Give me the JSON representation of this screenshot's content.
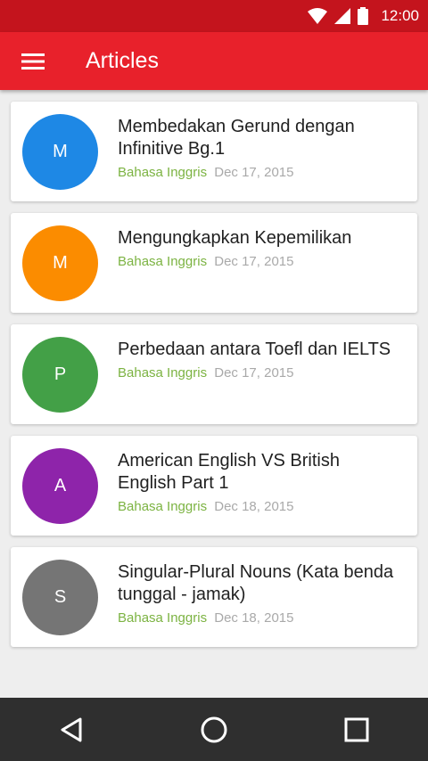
{
  "status_bar": {
    "time": "12:00"
  },
  "app_bar": {
    "title": "Articles",
    "menu_icon": "hamburger-menu-icon"
  },
  "articles": [
    {
      "initial": "M",
      "color": "#1e88e5",
      "title_line1": "Membedakan Gerund dengan",
      "title_line2": "Infinitive Bg.1",
      "category": "Bahasa Inggris",
      "date": "Dec 17, 2015"
    },
    {
      "initial": "M",
      "color": "#fb8c00",
      "title_line1": "Mengungkapkan Kepemilikan",
      "title_line2": "",
      "category": "Bahasa Inggris",
      "date": "Dec 17, 2015"
    },
    {
      "initial": "P",
      "color": "#43a047",
      "title_line1": "Perbedaan antara Toefl dan IELTS",
      "title_line2": "",
      "category": "Bahasa Inggris",
      "date": "Dec 17, 2015"
    },
    {
      "initial": "A",
      "color": "#8e24aa",
      "title_line1": "American English VS British",
      "title_line2": "English Part 1",
      "category": "Bahasa Inggris",
      "date": "Dec 18, 2015"
    },
    {
      "initial": "S",
      "color": "#757575",
      "title_line1": "Singular-Plural Nouns (Kata benda",
      "title_line2": "tunggal - jamak)",
      "category": "Bahasa Inggris",
      "date": "Dec 18, 2015"
    }
  ],
  "nav_bar": {
    "icons": [
      "back-icon",
      "home-icon",
      "recents-icon"
    ]
  }
}
